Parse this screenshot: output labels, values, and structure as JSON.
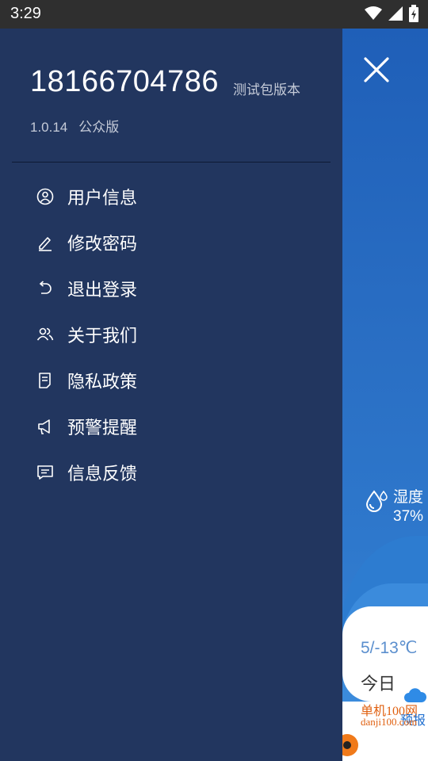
{
  "status_bar": {
    "time": "3:29"
  },
  "drawer": {
    "phone": "18166704786",
    "build_label": "测试包版本",
    "version": "1.0.14",
    "edition": "公众版",
    "menu": [
      {
        "label": "用户信息",
        "icon": "user-icon"
      },
      {
        "label": "修改密码",
        "icon": "pencil-icon"
      },
      {
        "label": "退出登录",
        "icon": "undo-icon"
      },
      {
        "label": "关于我们",
        "icon": "people-icon"
      },
      {
        "label": "隐私政策",
        "icon": "document-icon"
      },
      {
        "label": "预警提醒",
        "icon": "megaphone-icon"
      },
      {
        "label": "信息反馈",
        "icon": "message-icon"
      }
    ]
  },
  "background": {
    "humidity_label": "湿度",
    "humidity_value": "37%",
    "card_temp": "5/-13℃",
    "card_day": "今日",
    "watermark_site": "单机100网",
    "watermark_url": "danji100.com",
    "watermark_forecast": "预报"
  },
  "colors": {
    "drawer_bg": "#22365f",
    "app_blue": "#1f5fb8",
    "status_bar": "#2f2f2f",
    "accent_temp": "#5b8fce"
  }
}
